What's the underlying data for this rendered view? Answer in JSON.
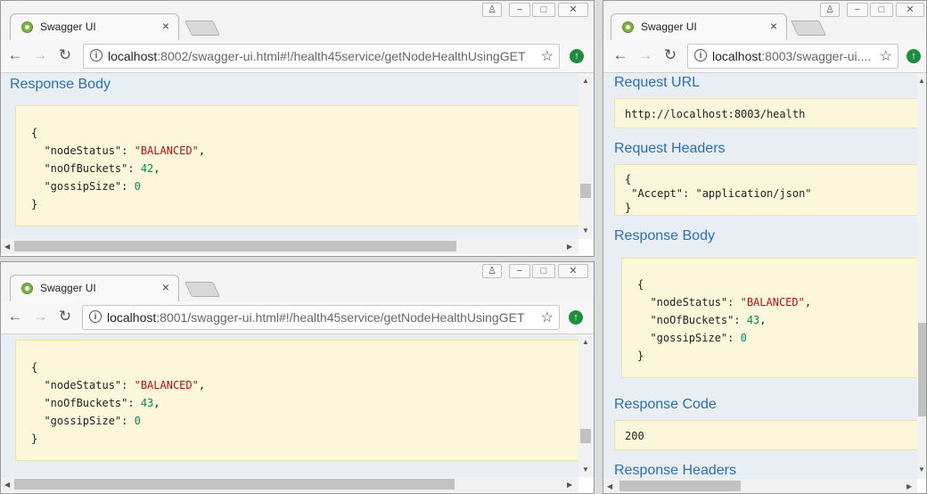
{
  "windows": {
    "top_left": {
      "tab_title": "Swagger UI",
      "url_host": "localhost",
      "url_rest": ":8002/swagger-ui.html#!/health45service/getNodeHealthUsingGET",
      "section_title": "Response Body",
      "json_open": "{",
      "json_close": "}",
      "key1": "\"nodeStatus\"",
      "val1": "\"BALANCED\"",
      "key2": "\"noOfBuckets\"",
      "val2": "42",
      "key3": "\"gossipSize\"",
      "val3": "0"
    },
    "bottom_left": {
      "tab_title": "Swagger UI",
      "url_host": "localhost",
      "url_rest": ":8001/swagger-ui.html#!/health45service/getNodeHealthUsingGET",
      "json_open": "{",
      "json_close": "}",
      "key1": "\"nodeStatus\"",
      "val1": "\"BALANCED\"",
      "key2": "\"noOfBuckets\"",
      "val2": "43",
      "key3": "\"gossipSize\"",
      "val3": "0"
    },
    "right": {
      "tab_title": "Swagger UI",
      "url_host": "localhost",
      "url_rest": ":8003/swagger-ui....",
      "request_url_title": "Request URL",
      "request_url": "http://localhost:8003/health",
      "request_headers_title": "Request Headers",
      "headers_open": "{",
      "headers_line": "\"Accept\": \"application/json\"",
      "headers_close": "}",
      "response_body_title": "Response Body",
      "json_open": "{",
      "json_close": "}",
      "key1": "\"nodeStatus\"",
      "val1": "\"BALANCED\"",
      "key2": "\"noOfBuckets\"",
      "val2": "43",
      "key3": "\"gossipSize\"",
      "val3": "0",
      "response_code_title": "Response Code",
      "response_code": "200",
      "response_headers_title": "Response Headers"
    }
  },
  "icons": {
    "close": "×",
    "back": "←",
    "forward": "→",
    "reload": "↻",
    "star": "☆",
    "info": "i",
    "ext": "↑",
    "user": "♙",
    "minimize": "−",
    "maximize": "□",
    "win_close": "✕",
    "up": "▲",
    "down": "▼",
    "left": "◀",
    "right": "▶"
  },
  "colors": {
    "section_title": "#2a6fb0",
    "code_bg": "#fcf6db",
    "string": "#a31515",
    "number": "#098658"
  }
}
